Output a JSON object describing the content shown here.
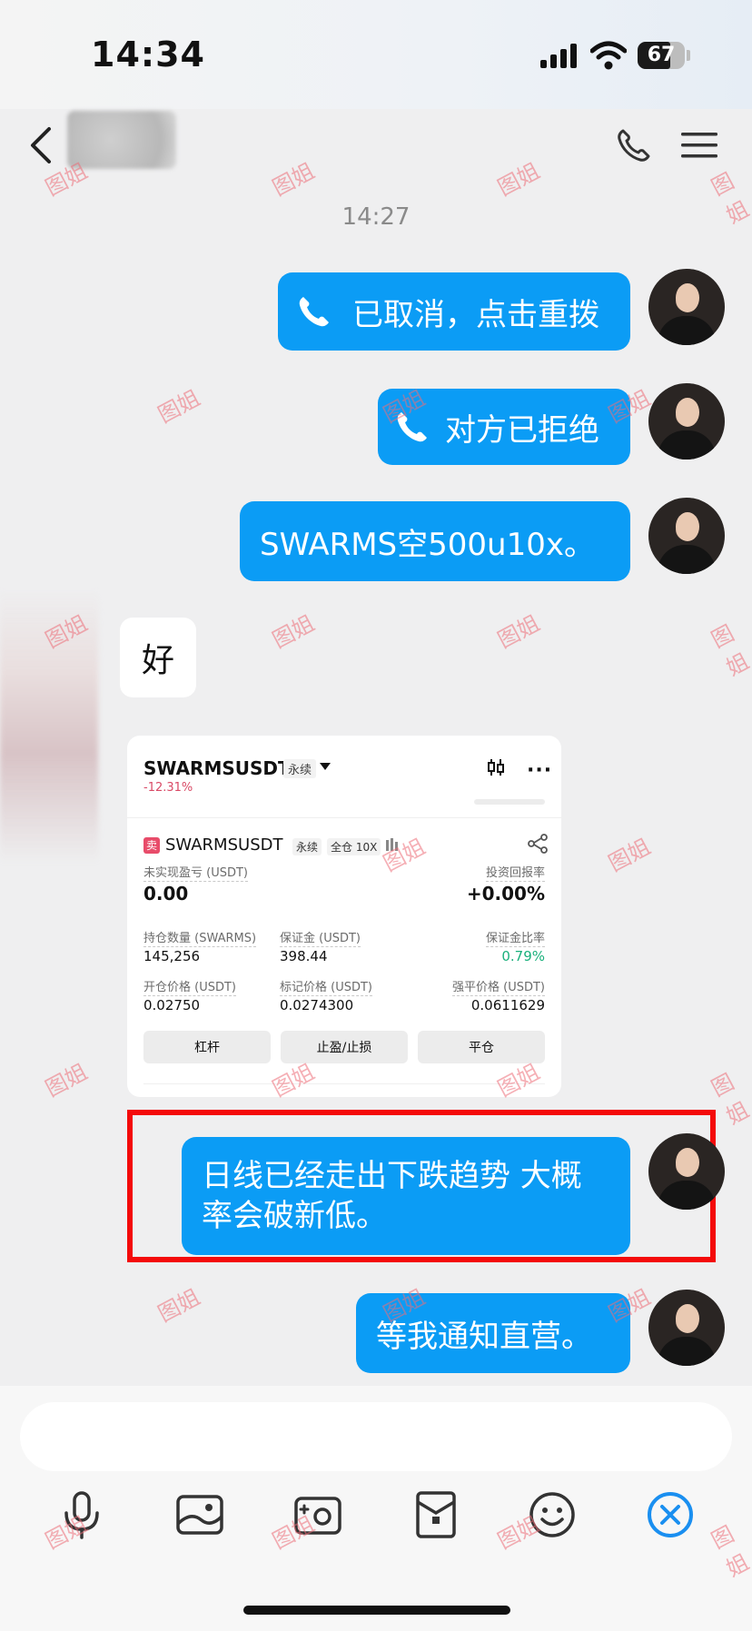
{
  "status_bar": {
    "time": "14:34",
    "battery": "67"
  },
  "header": {
    "icons": [
      "back-arrow-icon",
      "phone-icon",
      "menu-icon"
    ]
  },
  "timestamp": "14:27",
  "messages": [
    {
      "side": "right",
      "icon": "phone-icon",
      "text": "已取消，点击重拨"
    },
    {
      "side": "right",
      "icon": "phone-icon",
      "text": "对方已拒绝"
    },
    {
      "side": "right",
      "text": "SWARMS空500u10x。"
    },
    {
      "side": "left",
      "text": "好"
    },
    {
      "side": "right",
      "text_line1": "日线已经走出下跌趋势 大概",
      "text_line2": "率会破新低。"
    },
    {
      "side": "right",
      "text": "等我通知直营。"
    }
  ],
  "trade_card": {
    "symbol": "SWARMSUSDT",
    "tag": "永续",
    "change": "-12.31%",
    "position": {
      "sell_badge": "卖",
      "symbol": "SWARMSUSDT",
      "tag_type": "永续",
      "tag_margin": "全仓 10X",
      "unrealized_pnl_label": "未实现盈亏 (USDT)",
      "unrealized_pnl_value": "0.00",
      "roi_label": "投资回报率",
      "roi_value": "+0.00%",
      "size_label": "持仓数量 (SWARMS)",
      "size_value": "145,256",
      "margin_label": "保证金 (USDT)",
      "margin_value": "398.44",
      "margin_ratio_label": "保证金比率",
      "margin_ratio_value": "0.79%",
      "entry_label": "开仓价格 (USDT)",
      "entry_value": "0.02750",
      "mark_label": "标记价格 (USDT)",
      "mark_value": "0.0274300",
      "liq_label": "强平价格 (USDT)",
      "liq_value": "0.0611629"
    },
    "buttons": {
      "leverage": "杠杆",
      "tpsl": "止盈/止损",
      "close": "平仓"
    }
  },
  "toolbar": {
    "icons": [
      "microphone-icon",
      "image-icon",
      "camera-icon",
      "red-packet-icon",
      "emoji-icon",
      "close-circle-icon"
    ]
  },
  "watermark": "图姐",
  "colors": {
    "bubble": "#0b9cf5",
    "highlight": "#f40a0a",
    "negative": "#d94a66",
    "positive": "#1ab07c"
  }
}
